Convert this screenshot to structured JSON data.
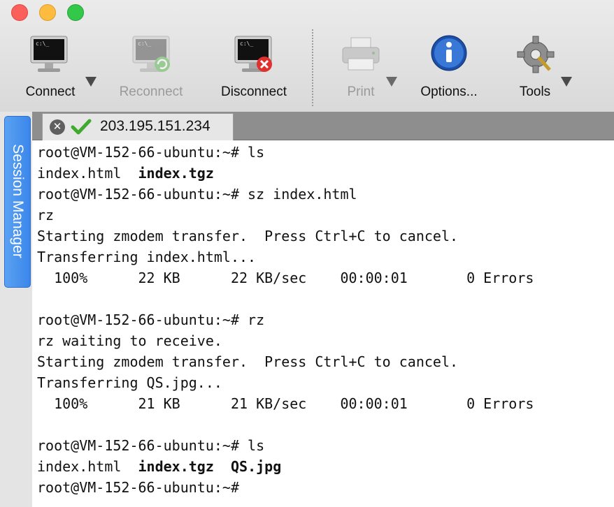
{
  "toolbar": {
    "connect": "Connect",
    "reconnect": "Reconnect",
    "disconnect": "Disconnect",
    "print": "Print",
    "options": "Options...",
    "tools": "Tools"
  },
  "side_panel": {
    "label": "Session Manager"
  },
  "tab": {
    "label": "203.195.151.234",
    "status_icon": "check-icon",
    "close_icon": "close-icon"
  },
  "terminal": {
    "prompt": "root@VM-152-66-ubuntu:~#",
    "lines": {
      "l1_cmd": " ls",
      "l2_file1": "index.html",
      "l2_file2": "index.tgz",
      "l3_cmd": " sz index.html",
      "l4": "rz",
      "l5": "Starting zmodem transfer.  Press Ctrl+C to cancel.",
      "l6": "Transferring index.html...",
      "l7": "  100%      22 KB      22 KB/sec    00:00:01       0 Errors",
      "l9_cmd": " rz",
      "l10": "rz waiting to receive.",
      "l11": "Starting zmodem transfer.  Press Ctrl+C to cancel.",
      "l12": "Transferring QS.jpg...",
      "l13": "  100%      21 KB      21 KB/sec    00:00:01       0 Errors",
      "l15_cmd": " ls",
      "l16_file1": "index.html",
      "l16_file2": "index.tgz",
      "l16_file3": "QS.jpg"
    }
  },
  "colors": {
    "accent": "#3b86ea",
    "close": "#fc605b",
    "minimize": "#fdbc40",
    "maximize": "#34c84a"
  }
}
